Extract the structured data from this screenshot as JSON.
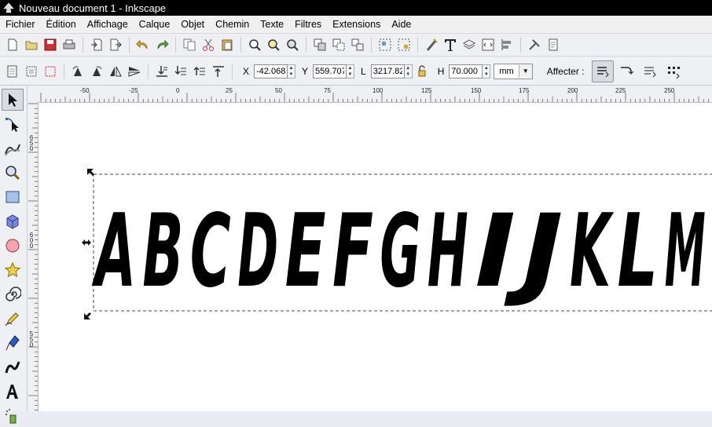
{
  "window": {
    "title": "Nouveau document 1 - Inkscape"
  },
  "menu": [
    {
      "label": "Fichier"
    },
    {
      "label": "Édition"
    },
    {
      "label": "Affichage"
    },
    {
      "label": "Calque"
    },
    {
      "label": "Objet"
    },
    {
      "label": "Chemin"
    },
    {
      "label": "Texte"
    },
    {
      "label": "Filtres"
    },
    {
      "label": "Extensions"
    },
    {
      "label": "Aide"
    }
  ],
  "toolbar1": {
    "icons": [
      "new-document-icon",
      "open-icon",
      "save-icon",
      "print-icon",
      "import-icon",
      "export-icon",
      "undo-icon",
      "redo-icon",
      "duplicate-icon",
      "cut-icon",
      "paste-icon",
      "zoom-selection-icon",
      "zoom-drawing-icon",
      "zoom-page-icon",
      "duplicate-object-icon",
      "clone-icon",
      "unlink-clone-icon",
      "group-icon",
      "ungroup-icon",
      "fill-stroke-icon",
      "text-font-icon",
      "layers-icon",
      "xml-editor-icon",
      "align-icon",
      "preferences-icon",
      "document-properties-icon"
    ]
  },
  "toolbar2": {
    "x_label": "X",
    "x_value": "-42.068",
    "y_label": "Y",
    "y_value": "559.707",
    "w_label": "L",
    "w_value": "3217.82",
    "h_label": "H",
    "h_value": "70.000",
    "unit": "mm",
    "affect_label": "Affecter :"
  },
  "ruler": {
    "h_labels": [
      "-50",
      "-25",
      "0",
      "25",
      "50",
      "75",
      "100",
      "125",
      "150",
      "175",
      "200",
      "225",
      "250"
    ],
    "v_labels": [
      "650",
      "600",
      "550"
    ]
  },
  "canvas": {
    "text_content": "ABCDEFGHIJKLM",
    "fill_color": "#000000"
  },
  "tools": [
    "selector-tool-icon",
    "node-tool-icon",
    "tweak-tool-icon",
    "zoom-tool-icon",
    "rectangle-tool-icon",
    "3d-box-tool-icon",
    "ellipse-tool-icon",
    "star-tool-icon",
    "spiral-tool-icon",
    "pencil-tool-icon",
    "pen-tool-icon",
    "calligraphy-tool-icon",
    "text-tool-icon",
    "spray-tool-icon"
  ]
}
